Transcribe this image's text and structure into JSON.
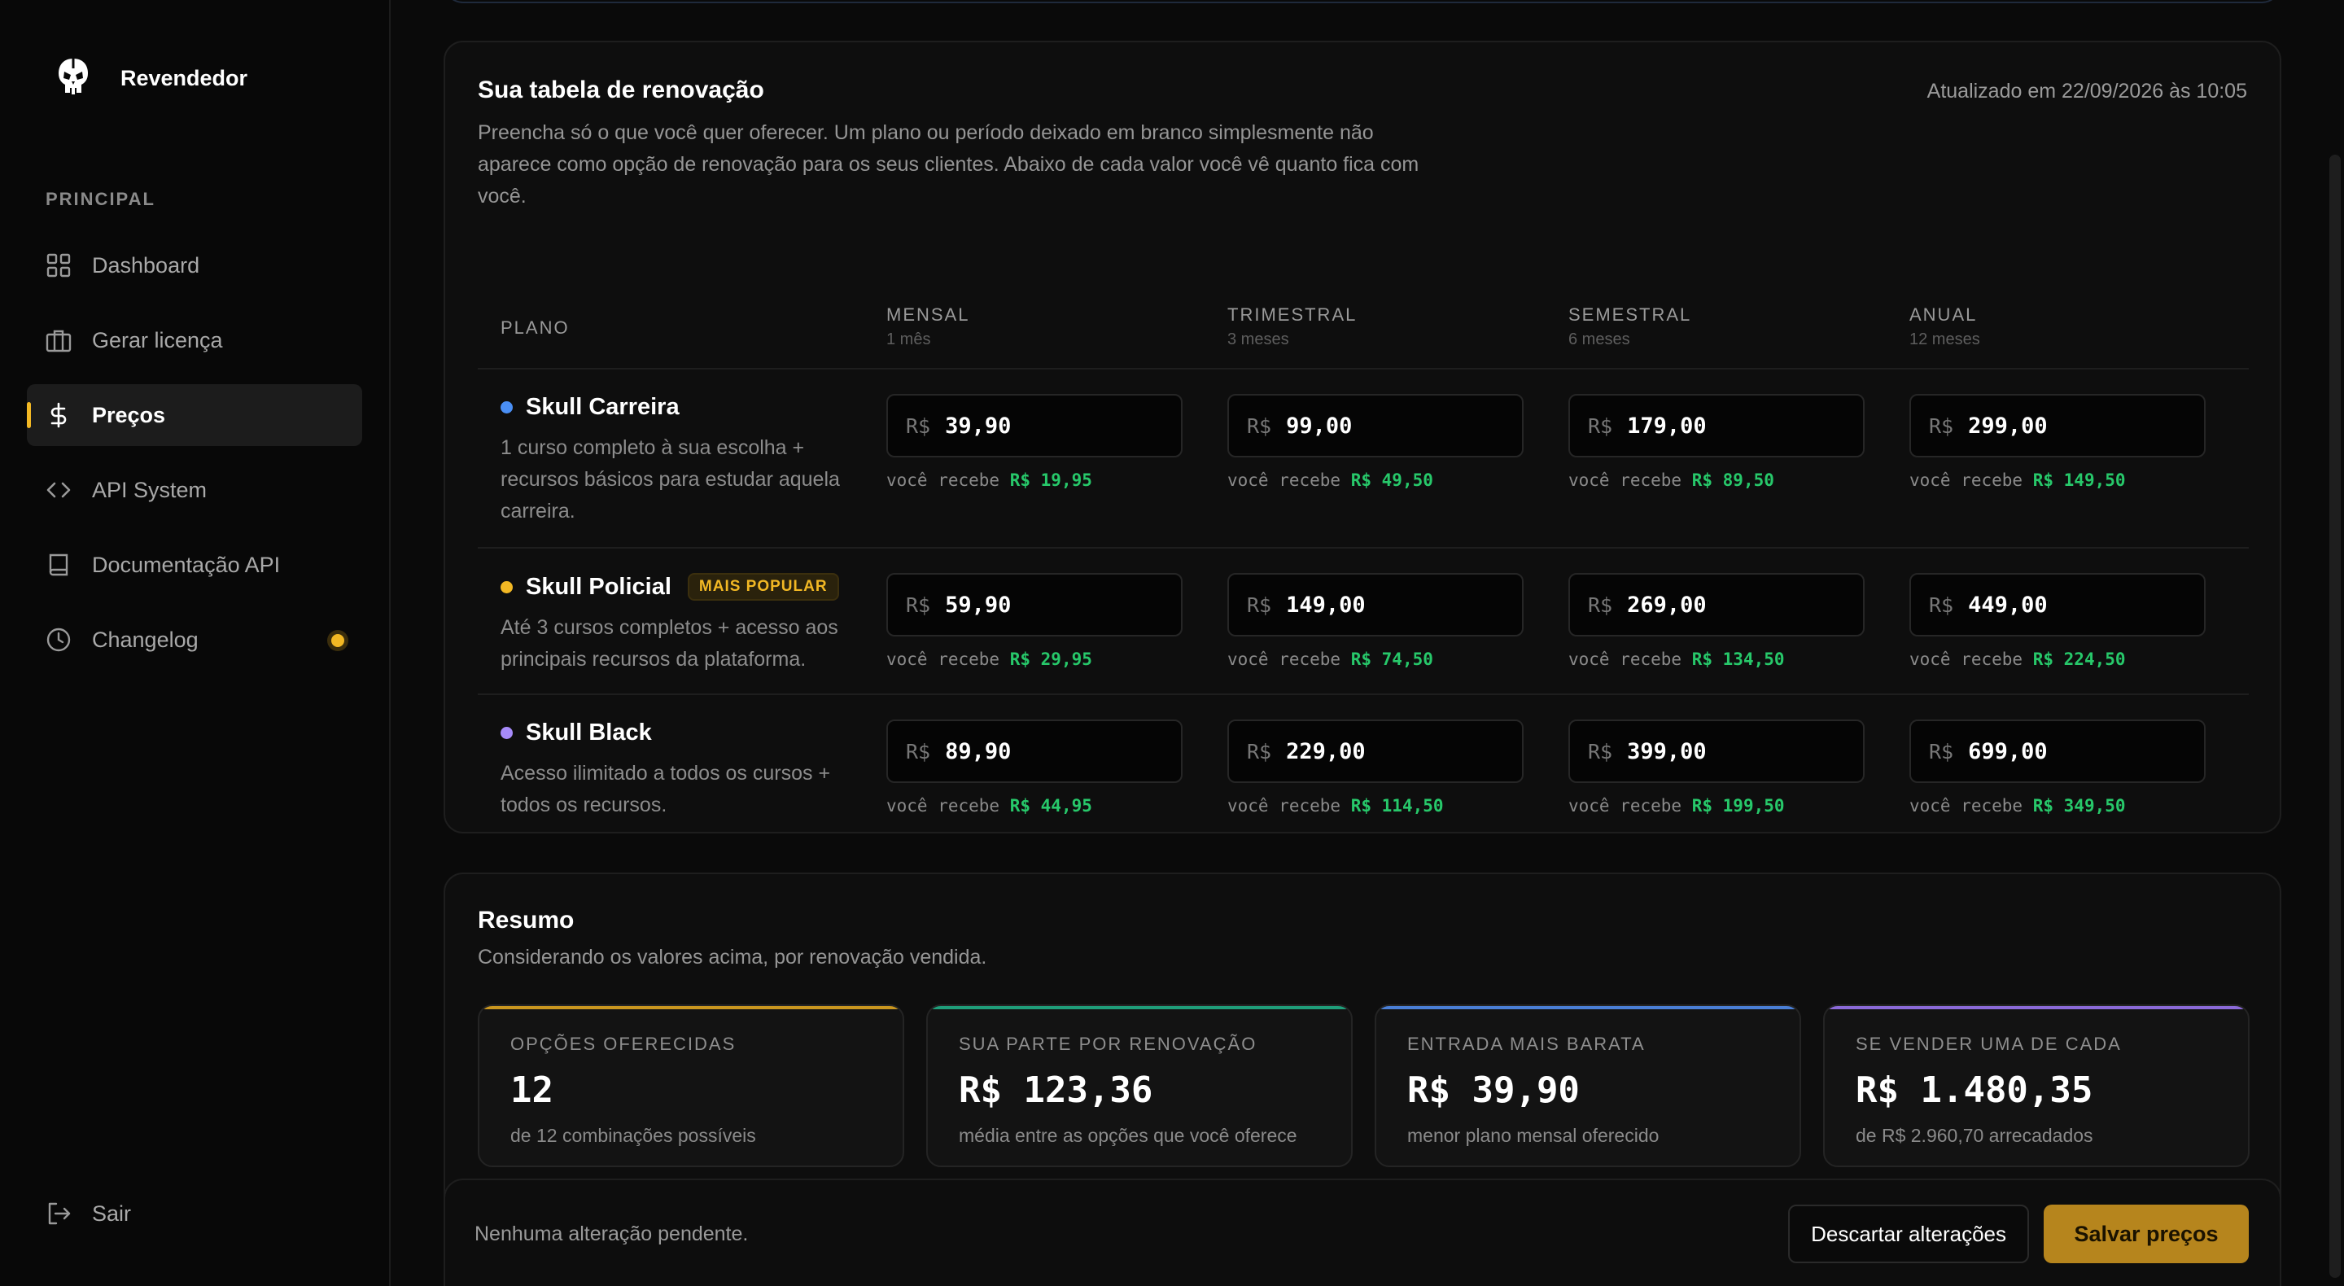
{
  "sidebar": {
    "brand": "Revendedor",
    "section": "PRINCIPAL",
    "items": [
      {
        "label": "Dashboard",
        "icon": "grid-icon"
      },
      {
        "label": "Gerar licença",
        "icon": "briefcase-icon"
      },
      {
        "label": "Preços",
        "icon": "dollar-icon",
        "active": true
      },
      {
        "label": "API System",
        "icon": "code-icon"
      },
      {
        "label": "Documentação API",
        "icon": "book-icon"
      },
      {
        "label": "Changelog",
        "icon": "clock-icon",
        "notification": true
      }
    ],
    "logout": "Sair"
  },
  "pricing": {
    "title": "Sua tabela de renovação",
    "updated": "Atualizado em 22/09/2026 às 10:05",
    "description": "Preencha só o que você quer oferecer. Um plano ou período deixado em branco simplesmente não aparece como opção de renovação para os seus clientes. Abaixo de cada valor você vê quanto fica com você.",
    "columns": {
      "plan": "PLANO",
      "periods": [
        {
          "label": "MENSAL",
          "sub": "1 mês"
        },
        {
          "label": "TRIMESTRAL",
          "sub": "3 meses"
        },
        {
          "label": "SEMESTRAL",
          "sub": "6 meses"
        },
        {
          "label": "ANUAL",
          "sub": "12 meses"
        }
      ]
    },
    "currency": "R$",
    "receive_label": "você recebe",
    "plans": [
      {
        "name": "Skull Carreira",
        "color": "#4a8ff5",
        "description": "1 curso completo à sua escolha + recursos básicos para estudar aquela carreira.",
        "prices": [
          "39,90",
          "99,00",
          "179,00",
          "299,00"
        ],
        "receive": [
          "R$ 19,95",
          "R$ 49,50",
          "R$ 89,50",
          "R$ 149,50"
        ]
      },
      {
        "name": "Skull Policial",
        "color": "#f2b824",
        "badge": "MAIS POPULAR",
        "description": "Até 3 cursos completos + acesso aos principais recursos da plataforma.",
        "prices": [
          "59,90",
          "149,00",
          "269,00",
          "449,00"
        ],
        "receive": [
          "R$ 29,95",
          "R$ 74,50",
          "R$ 134,50",
          "R$ 224,50"
        ]
      },
      {
        "name": "Skull Black",
        "color": "#a78bfa",
        "description": "Acesso ilimitado a todos os cursos + todos os recursos.",
        "prices": [
          "89,90",
          "229,00",
          "399,00",
          "699,00"
        ],
        "receive": [
          "R$ 44,95",
          "R$ 114,50",
          "R$ 199,50",
          "R$ 349,50"
        ]
      }
    ]
  },
  "summary": {
    "title": "Resumo",
    "description": "Considerando os valores acima, por renovação vendida.",
    "stats": [
      {
        "label": "OPÇÕES OFERECIDAS",
        "value": "12",
        "sub": "de 12 combinações possíveis",
        "accent": "#c9961f"
      },
      {
        "label": "SUA PARTE POR RENOVAÇÃO",
        "value": "R$ 123,36",
        "sub": "média entre as opções que você oferece",
        "accent": "#1f9e7a"
      },
      {
        "label": "ENTRADA MAIS BARATA",
        "value": "R$ 39,90",
        "sub": "menor plano mensal oferecido",
        "accent": "#4a7fd6"
      },
      {
        "label": "SE VENDER UMA DE CADA",
        "value": "R$ 1.480,35",
        "sub": "de R$ 2.960,70 arrecadados",
        "accent": "#8b6ad8"
      }
    ]
  },
  "footer": {
    "pending": "Nenhuma alteração pendente.",
    "discard": "Descartar alterações",
    "save": "Salvar preços"
  }
}
